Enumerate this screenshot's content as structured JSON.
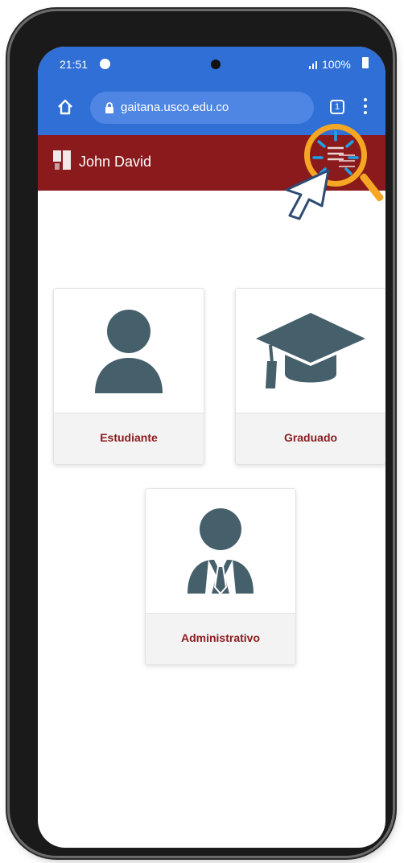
{
  "status_bar": {
    "time": "21:51",
    "battery": "100%"
  },
  "browser": {
    "url": "gaitana.usco.edu.co",
    "tab_count": "1"
  },
  "app_header": {
    "user_name": "John David"
  },
  "roles": [
    {
      "label": "Estudiante",
      "icon": "student-icon"
    },
    {
      "label": "Graduado",
      "icon": "graduation-cap-icon"
    },
    {
      "label": "Administrativo",
      "icon": "administrative-icon"
    }
  ],
  "colors": {
    "browser_bar": "#2f6fd6",
    "header": "#8b1a1d",
    "label_text": "#8b1a1d",
    "icon_fill": "#455f6b",
    "highlight": "#f5a623",
    "sparkle": "#1aa3e8"
  }
}
